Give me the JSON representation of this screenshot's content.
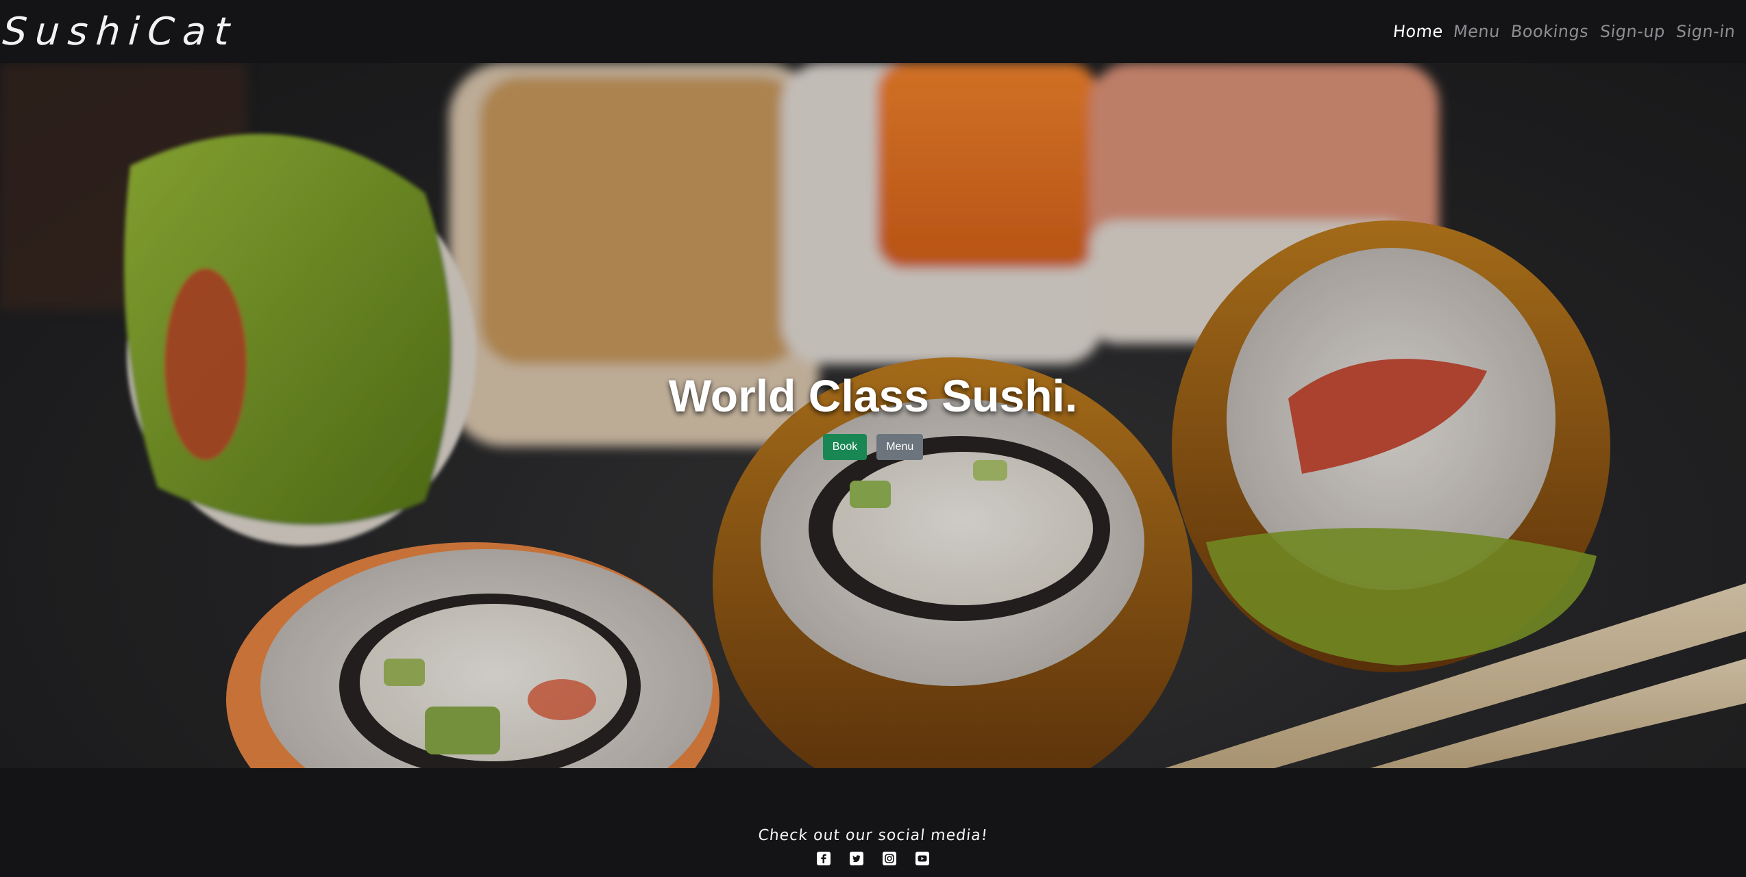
{
  "brand": {
    "name": "SushiCat"
  },
  "nav": {
    "items": [
      {
        "label": "Home",
        "active": true
      },
      {
        "label": "Menu",
        "active": false
      },
      {
        "label": "Bookings",
        "active": false
      },
      {
        "label": "Sign-up",
        "active": false
      },
      {
        "label": "Sign-in",
        "active": false
      }
    ]
  },
  "hero": {
    "title": "World Class Sushi.",
    "book_label": "Book",
    "menu_label": "Menu"
  },
  "footer": {
    "text": "Check out our social media!",
    "socials": [
      "facebook-icon",
      "twitter-icon",
      "instagram-icon",
      "youtube-icon"
    ]
  },
  "colors": {
    "background": "#141315",
    "book_button": "#198754",
    "menu_button": "#6c757d",
    "nav_inactive": "#8d8d92"
  }
}
